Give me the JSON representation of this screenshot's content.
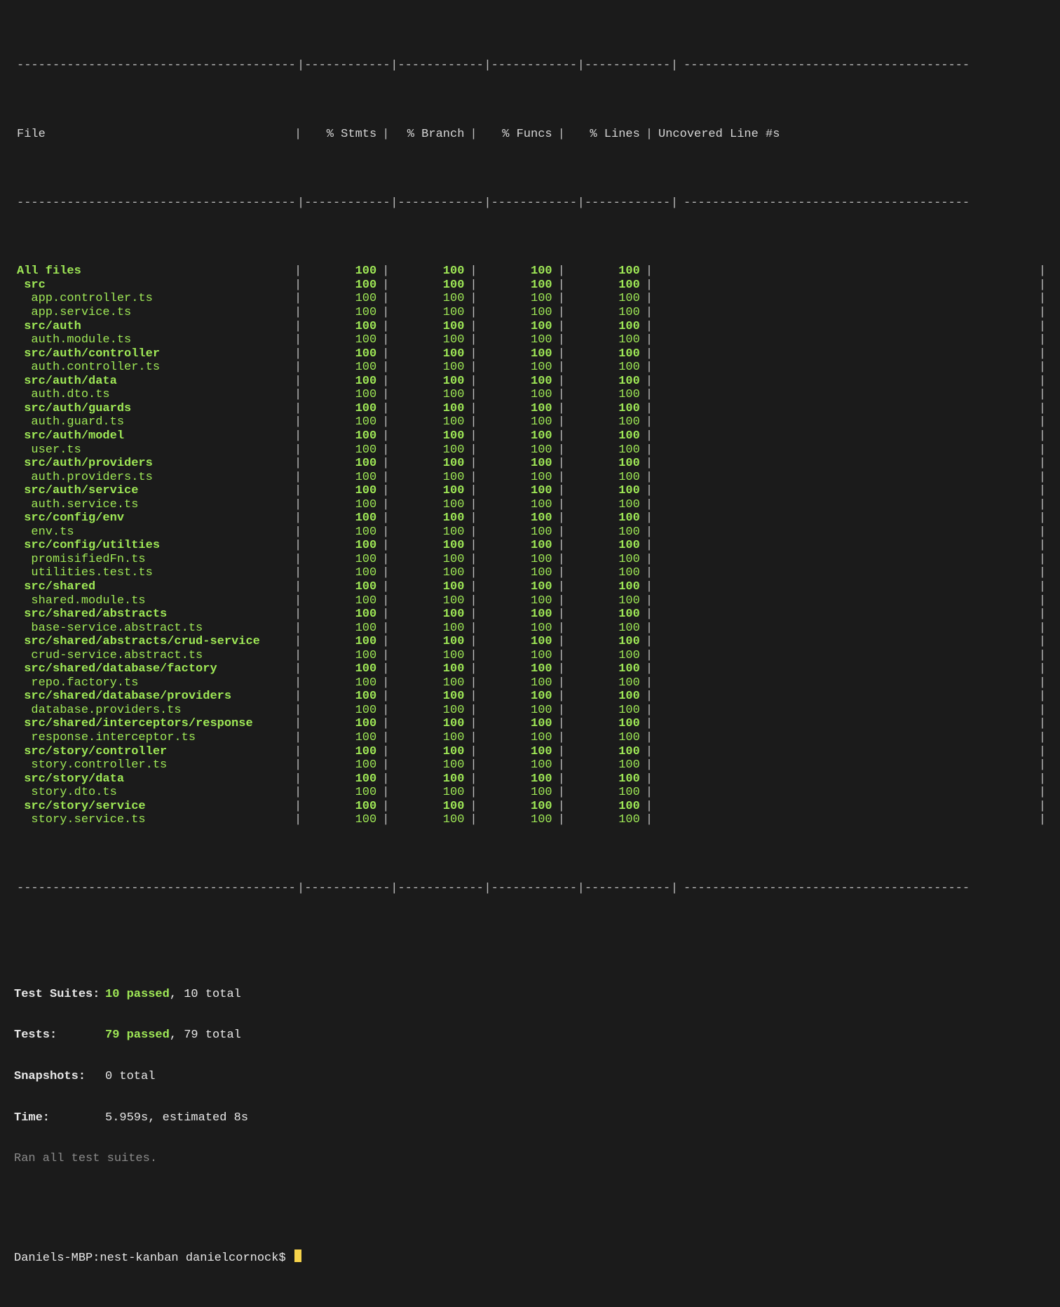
{
  "table": {
    "headers": {
      "file": "File",
      "stmts": "% Stmts",
      "branch": "% Branch",
      "funcs": "% Funcs",
      "lines": "% Lines",
      "uncovered": "Uncovered Line #s"
    },
    "rows": [
      {
        "file": "All files",
        "indent": 0,
        "bold": true,
        "stmts": "100",
        "branch": "100",
        "funcs": "100",
        "lines": "100",
        "uncovered": ""
      },
      {
        "file": "src",
        "indent": 1,
        "bold": true,
        "stmts": "100",
        "branch": "100",
        "funcs": "100",
        "lines": "100",
        "uncovered": ""
      },
      {
        "file": "app.controller.ts",
        "indent": 2,
        "bold": false,
        "stmts": "100",
        "branch": "100",
        "funcs": "100",
        "lines": "100",
        "uncovered": ""
      },
      {
        "file": "app.service.ts",
        "indent": 2,
        "bold": false,
        "stmts": "100",
        "branch": "100",
        "funcs": "100",
        "lines": "100",
        "uncovered": ""
      },
      {
        "file": "src/auth",
        "indent": 1,
        "bold": true,
        "stmts": "100",
        "branch": "100",
        "funcs": "100",
        "lines": "100",
        "uncovered": ""
      },
      {
        "file": "auth.module.ts",
        "indent": 2,
        "bold": false,
        "stmts": "100",
        "branch": "100",
        "funcs": "100",
        "lines": "100",
        "uncovered": ""
      },
      {
        "file": "src/auth/controller",
        "indent": 1,
        "bold": true,
        "stmts": "100",
        "branch": "100",
        "funcs": "100",
        "lines": "100",
        "uncovered": ""
      },
      {
        "file": "auth.controller.ts",
        "indent": 2,
        "bold": false,
        "stmts": "100",
        "branch": "100",
        "funcs": "100",
        "lines": "100",
        "uncovered": ""
      },
      {
        "file": "src/auth/data",
        "indent": 1,
        "bold": true,
        "stmts": "100",
        "branch": "100",
        "funcs": "100",
        "lines": "100",
        "uncovered": ""
      },
      {
        "file": "auth.dto.ts",
        "indent": 2,
        "bold": false,
        "stmts": "100",
        "branch": "100",
        "funcs": "100",
        "lines": "100",
        "uncovered": ""
      },
      {
        "file": "src/auth/guards",
        "indent": 1,
        "bold": true,
        "stmts": "100",
        "branch": "100",
        "funcs": "100",
        "lines": "100",
        "uncovered": ""
      },
      {
        "file": "auth.guard.ts",
        "indent": 2,
        "bold": false,
        "stmts": "100",
        "branch": "100",
        "funcs": "100",
        "lines": "100",
        "uncovered": ""
      },
      {
        "file": "src/auth/model",
        "indent": 1,
        "bold": true,
        "stmts": "100",
        "branch": "100",
        "funcs": "100",
        "lines": "100",
        "uncovered": ""
      },
      {
        "file": "user.ts",
        "indent": 2,
        "bold": false,
        "stmts": "100",
        "branch": "100",
        "funcs": "100",
        "lines": "100",
        "uncovered": ""
      },
      {
        "file": "src/auth/providers",
        "indent": 1,
        "bold": true,
        "stmts": "100",
        "branch": "100",
        "funcs": "100",
        "lines": "100",
        "uncovered": ""
      },
      {
        "file": "auth.providers.ts",
        "indent": 2,
        "bold": false,
        "stmts": "100",
        "branch": "100",
        "funcs": "100",
        "lines": "100",
        "uncovered": ""
      },
      {
        "file": "src/auth/service",
        "indent": 1,
        "bold": true,
        "stmts": "100",
        "branch": "100",
        "funcs": "100",
        "lines": "100",
        "uncovered": ""
      },
      {
        "file": "auth.service.ts",
        "indent": 2,
        "bold": false,
        "stmts": "100",
        "branch": "100",
        "funcs": "100",
        "lines": "100",
        "uncovered": ""
      },
      {
        "file": "src/config/env",
        "indent": 1,
        "bold": true,
        "stmts": "100",
        "branch": "100",
        "funcs": "100",
        "lines": "100",
        "uncovered": ""
      },
      {
        "file": "env.ts",
        "indent": 2,
        "bold": false,
        "stmts": "100",
        "branch": "100",
        "funcs": "100",
        "lines": "100",
        "uncovered": ""
      },
      {
        "file": "src/config/utilties",
        "indent": 1,
        "bold": true,
        "stmts": "100",
        "branch": "100",
        "funcs": "100",
        "lines": "100",
        "uncovered": ""
      },
      {
        "file": "promisifiedFn.ts",
        "indent": 2,
        "bold": false,
        "stmts": "100",
        "branch": "100",
        "funcs": "100",
        "lines": "100",
        "uncovered": ""
      },
      {
        "file": "utilities.test.ts",
        "indent": 2,
        "bold": false,
        "stmts": "100",
        "branch": "100",
        "funcs": "100",
        "lines": "100",
        "uncovered": ""
      },
      {
        "file": "src/shared",
        "indent": 1,
        "bold": true,
        "stmts": "100",
        "branch": "100",
        "funcs": "100",
        "lines": "100",
        "uncovered": ""
      },
      {
        "file": "shared.module.ts",
        "indent": 2,
        "bold": false,
        "stmts": "100",
        "branch": "100",
        "funcs": "100",
        "lines": "100",
        "uncovered": ""
      },
      {
        "file": "src/shared/abstracts",
        "indent": 1,
        "bold": true,
        "stmts": "100",
        "branch": "100",
        "funcs": "100",
        "lines": "100",
        "uncovered": ""
      },
      {
        "file": "base-service.abstract.ts",
        "indent": 2,
        "bold": false,
        "stmts": "100",
        "branch": "100",
        "funcs": "100",
        "lines": "100",
        "uncovered": ""
      },
      {
        "file": "src/shared/abstracts/crud-service",
        "indent": 1,
        "bold": true,
        "stmts": "100",
        "branch": "100",
        "funcs": "100",
        "lines": "100",
        "uncovered": ""
      },
      {
        "file": "crud-service.abstract.ts",
        "indent": 2,
        "bold": false,
        "stmts": "100",
        "branch": "100",
        "funcs": "100",
        "lines": "100",
        "uncovered": ""
      },
      {
        "file": "src/shared/database/factory",
        "indent": 1,
        "bold": true,
        "stmts": "100",
        "branch": "100",
        "funcs": "100",
        "lines": "100",
        "uncovered": ""
      },
      {
        "file": "repo.factory.ts",
        "indent": 2,
        "bold": false,
        "stmts": "100",
        "branch": "100",
        "funcs": "100",
        "lines": "100",
        "uncovered": ""
      },
      {
        "file": "src/shared/database/providers",
        "indent": 1,
        "bold": true,
        "stmts": "100",
        "branch": "100",
        "funcs": "100",
        "lines": "100",
        "uncovered": ""
      },
      {
        "file": "database.providers.ts",
        "indent": 2,
        "bold": false,
        "stmts": "100",
        "branch": "100",
        "funcs": "100",
        "lines": "100",
        "uncovered": ""
      },
      {
        "file": "src/shared/interceptors/response",
        "indent": 1,
        "bold": true,
        "stmts": "100",
        "branch": "100",
        "funcs": "100",
        "lines": "100",
        "uncovered": ""
      },
      {
        "file": "response.interceptor.ts",
        "indent": 2,
        "bold": false,
        "stmts": "100",
        "branch": "100",
        "funcs": "100",
        "lines": "100",
        "uncovered": ""
      },
      {
        "file": "src/story/controller",
        "indent": 1,
        "bold": true,
        "stmts": "100",
        "branch": "100",
        "funcs": "100",
        "lines": "100",
        "uncovered": ""
      },
      {
        "file": "story.controller.ts",
        "indent": 2,
        "bold": false,
        "stmts": "100",
        "branch": "100",
        "funcs": "100",
        "lines": "100",
        "uncovered": ""
      },
      {
        "file": "src/story/data",
        "indent": 1,
        "bold": true,
        "stmts": "100",
        "branch": "100",
        "funcs": "100",
        "lines": "100",
        "uncovered": ""
      },
      {
        "file": "story.dto.ts",
        "indent": 2,
        "bold": false,
        "stmts": "100",
        "branch": "100",
        "funcs": "100",
        "lines": "100",
        "uncovered": ""
      },
      {
        "file": "src/story/service",
        "indent": 1,
        "bold": true,
        "stmts": "100",
        "branch": "100",
        "funcs": "100",
        "lines": "100",
        "uncovered": ""
      },
      {
        "file": "story.service.ts",
        "indent": 2,
        "bold": false,
        "stmts": "100",
        "branch": "100",
        "funcs": "100",
        "lines": "100",
        "uncovered": ""
      }
    ]
  },
  "summary": {
    "testSuites": {
      "label": "Test Suites:",
      "passed": "10 passed",
      "rest": ", 10 total"
    },
    "tests": {
      "label": "Tests:",
      "passed": "79 passed",
      "rest": ", 79 total"
    },
    "snapshots": {
      "label": "Snapshots:",
      "value": "0 total"
    },
    "time": {
      "label": "Time:",
      "value": "5.959s, estimated 8s"
    },
    "footer": "Ran all test suites."
  },
  "prompt": {
    "text": "Daniels-MBP:nest-kanban danielcornock$ "
  },
  "colWidths": {
    "file": 37,
    "stmts": 10,
    "branch": 10,
    "funcs": 10,
    "lines": 10,
    "uncovered": 20
  }
}
